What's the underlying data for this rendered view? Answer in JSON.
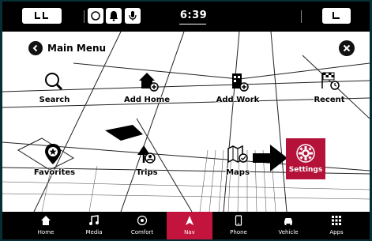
{
  "status": {
    "time": "6:39"
  },
  "map_menu": {
    "title": "Main Menu",
    "tiles": {
      "search": "Search",
      "add_home": "Add Home",
      "add_work": "Add Work",
      "recent": "Recent",
      "favorites": "Favorites",
      "trips": "Trips",
      "maps": "Maps",
      "settings": "Settings"
    }
  },
  "navbar": {
    "items": [
      {
        "label": "Home",
        "icon": "home-icon"
      },
      {
        "label": "Media",
        "icon": "music-note-icon"
      },
      {
        "label": "Comfort",
        "icon": "climate-icon"
      },
      {
        "label": "Nav",
        "icon": "navigation-arrow-icon"
      },
      {
        "label": "Phone",
        "icon": "phone-icon"
      },
      {
        "label": "Vehicle",
        "icon": "car-icon"
      },
      {
        "label": "Apps",
        "icon": "apps-grid-icon"
      }
    ],
    "active": "Nav"
  },
  "colors": {
    "accent": "#c2143c",
    "settings_tile": "#b5123a",
    "frame": "#062f35"
  }
}
